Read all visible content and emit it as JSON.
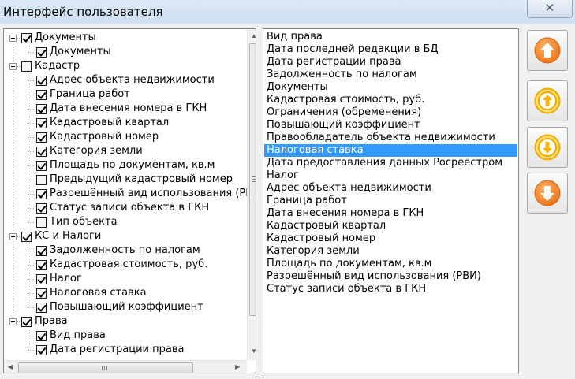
{
  "window": {
    "title": "Интерфейс пользователя",
    "close_glyph": "✕"
  },
  "tree": {
    "groups": [
      {
        "label": "Документы",
        "checked": true,
        "items": [
          {
            "label": "Документы",
            "checked": true
          }
        ]
      },
      {
        "label": "Кадастр",
        "checked": false,
        "items": [
          {
            "label": "Адрес объекта недвижимости",
            "checked": true
          },
          {
            "label": "Граница работ",
            "checked": true
          },
          {
            "label": "Дата внесения номера в ГКН",
            "checked": true
          },
          {
            "label": "Кадастровый квартал",
            "checked": true
          },
          {
            "label": "Кадастровый номер",
            "checked": true
          },
          {
            "label": "Категория земли",
            "checked": true
          },
          {
            "label": "Площадь по документам, кв.м",
            "checked": true
          },
          {
            "label": "Предыдущий кадастровый номер",
            "checked": false
          },
          {
            "label": "Разрешённый вид использования (РВ",
            "checked": true
          },
          {
            "label": "Статус записи объекта в ГКН",
            "checked": true
          },
          {
            "label": "Тип объекта",
            "checked": false
          }
        ]
      },
      {
        "label": "КС и Налоги",
        "checked": true,
        "items": [
          {
            "label": "Задолженность по налогам",
            "checked": true
          },
          {
            "label": "Кадастровая стоимость, руб.",
            "checked": true
          },
          {
            "label": "Налог",
            "checked": true
          },
          {
            "label": "Налоговая ставка",
            "checked": true
          },
          {
            "label": "Повышающий коэффициент",
            "checked": true
          }
        ]
      },
      {
        "label": "Права",
        "checked": true,
        "items": [
          {
            "label": "Вид права",
            "checked": true
          },
          {
            "label": "Дата регистрации права",
            "checked": true
          }
        ]
      }
    ]
  },
  "list": {
    "items": [
      "Вид права",
      "Дата последней редакции в БД",
      "Дата регистрации права",
      "Задолженность по налогам",
      "Документы",
      "Кадастровая стоимость, руб.",
      "Ограничения (обременения)",
      "Повышающий коэффициент",
      "Правообладатель объекта недвижимости",
      "Налоговая ставка",
      "Дата предоставления данных Росреестром",
      "Налог",
      "Адрес объекта недвижимости",
      "Граница работ",
      "Дата внесения номера в ГКН",
      "Кадастровый квартал",
      "Кадастровый номер",
      "Категория земли",
      "Площадь по документам, кв.м",
      "Разрешённый вид использования (РВИ)",
      "Статус записи объекта в ГКН"
    ],
    "selected_index": 9,
    "selected_color": "#3399ff"
  },
  "buttons": [
    {
      "name": "move-top-button",
      "icon": "arrow-up-filled-icon"
    },
    {
      "name": "move-up-button",
      "icon": "arrow-up-outline-icon"
    },
    {
      "name": "move-down-button",
      "icon": "arrow-down-outline-icon"
    },
    {
      "name": "move-bottom-button",
      "icon": "arrow-down-filled-icon"
    }
  ],
  "colors": {
    "accent_orange": "#f08a24",
    "ring_yellow": "#f6b800"
  }
}
